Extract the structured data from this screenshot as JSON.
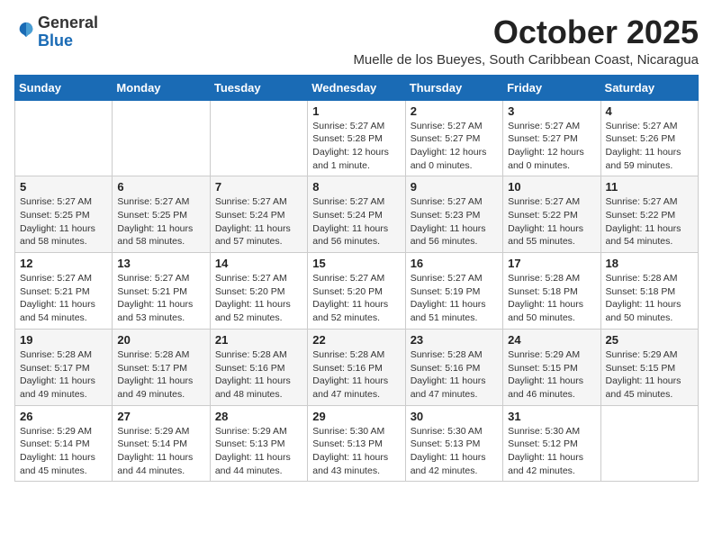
{
  "header": {
    "logo_general": "General",
    "logo_blue": "Blue",
    "month_title": "October 2025",
    "location": "Muelle de los Bueyes, South Caribbean Coast, Nicaragua"
  },
  "days_of_week": [
    "Sunday",
    "Monday",
    "Tuesday",
    "Wednesday",
    "Thursday",
    "Friday",
    "Saturday"
  ],
  "weeks": [
    [
      {
        "day": "",
        "info": ""
      },
      {
        "day": "",
        "info": ""
      },
      {
        "day": "",
        "info": ""
      },
      {
        "day": "1",
        "info": "Sunrise: 5:27 AM\nSunset: 5:28 PM\nDaylight: 12 hours\nand 1 minute."
      },
      {
        "day": "2",
        "info": "Sunrise: 5:27 AM\nSunset: 5:27 PM\nDaylight: 12 hours\nand 0 minutes."
      },
      {
        "day": "3",
        "info": "Sunrise: 5:27 AM\nSunset: 5:27 PM\nDaylight: 12 hours\nand 0 minutes."
      },
      {
        "day": "4",
        "info": "Sunrise: 5:27 AM\nSunset: 5:26 PM\nDaylight: 11 hours\nand 59 minutes."
      }
    ],
    [
      {
        "day": "5",
        "info": "Sunrise: 5:27 AM\nSunset: 5:25 PM\nDaylight: 11 hours\nand 58 minutes."
      },
      {
        "day": "6",
        "info": "Sunrise: 5:27 AM\nSunset: 5:25 PM\nDaylight: 11 hours\nand 58 minutes."
      },
      {
        "day": "7",
        "info": "Sunrise: 5:27 AM\nSunset: 5:24 PM\nDaylight: 11 hours\nand 57 minutes."
      },
      {
        "day": "8",
        "info": "Sunrise: 5:27 AM\nSunset: 5:24 PM\nDaylight: 11 hours\nand 56 minutes."
      },
      {
        "day": "9",
        "info": "Sunrise: 5:27 AM\nSunset: 5:23 PM\nDaylight: 11 hours\nand 56 minutes."
      },
      {
        "day": "10",
        "info": "Sunrise: 5:27 AM\nSunset: 5:22 PM\nDaylight: 11 hours\nand 55 minutes."
      },
      {
        "day": "11",
        "info": "Sunrise: 5:27 AM\nSunset: 5:22 PM\nDaylight: 11 hours\nand 54 minutes."
      }
    ],
    [
      {
        "day": "12",
        "info": "Sunrise: 5:27 AM\nSunset: 5:21 PM\nDaylight: 11 hours\nand 54 minutes."
      },
      {
        "day": "13",
        "info": "Sunrise: 5:27 AM\nSunset: 5:21 PM\nDaylight: 11 hours\nand 53 minutes."
      },
      {
        "day": "14",
        "info": "Sunrise: 5:27 AM\nSunset: 5:20 PM\nDaylight: 11 hours\nand 52 minutes."
      },
      {
        "day": "15",
        "info": "Sunrise: 5:27 AM\nSunset: 5:20 PM\nDaylight: 11 hours\nand 52 minutes."
      },
      {
        "day": "16",
        "info": "Sunrise: 5:27 AM\nSunset: 5:19 PM\nDaylight: 11 hours\nand 51 minutes."
      },
      {
        "day": "17",
        "info": "Sunrise: 5:28 AM\nSunset: 5:18 PM\nDaylight: 11 hours\nand 50 minutes."
      },
      {
        "day": "18",
        "info": "Sunrise: 5:28 AM\nSunset: 5:18 PM\nDaylight: 11 hours\nand 50 minutes."
      }
    ],
    [
      {
        "day": "19",
        "info": "Sunrise: 5:28 AM\nSunset: 5:17 PM\nDaylight: 11 hours\nand 49 minutes."
      },
      {
        "day": "20",
        "info": "Sunrise: 5:28 AM\nSunset: 5:17 PM\nDaylight: 11 hours\nand 49 minutes."
      },
      {
        "day": "21",
        "info": "Sunrise: 5:28 AM\nSunset: 5:16 PM\nDaylight: 11 hours\nand 48 minutes."
      },
      {
        "day": "22",
        "info": "Sunrise: 5:28 AM\nSunset: 5:16 PM\nDaylight: 11 hours\nand 47 minutes."
      },
      {
        "day": "23",
        "info": "Sunrise: 5:28 AM\nSunset: 5:16 PM\nDaylight: 11 hours\nand 47 minutes."
      },
      {
        "day": "24",
        "info": "Sunrise: 5:29 AM\nSunset: 5:15 PM\nDaylight: 11 hours\nand 46 minutes."
      },
      {
        "day": "25",
        "info": "Sunrise: 5:29 AM\nSunset: 5:15 PM\nDaylight: 11 hours\nand 45 minutes."
      }
    ],
    [
      {
        "day": "26",
        "info": "Sunrise: 5:29 AM\nSunset: 5:14 PM\nDaylight: 11 hours\nand 45 minutes."
      },
      {
        "day": "27",
        "info": "Sunrise: 5:29 AM\nSunset: 5:14 PM\nDaylight: 11 hours\nand 44 minutes."
      },
      {
        "day": "28",
        "info": "Sunrise: 5:29 AM\nSunset: 5:13 PM\nDaylight: 11 hours\nand 44 minutes."
      },
      {
        "day": "29",
        "info": "Sunrise: 5:30 AM\nSunset: 5:13 PM\nDaylight: 11 hours\nand 43 minutes."
      },
      {
        "day": "30",
        "info": "Sunrise: 5:30 AM\nSunset: 5:13 PM\nDaylight: 11 hours\nand 42 minutes."
      },
      {
        "day": "31",
        "info": "Sunrise: 5:30 AM\nSunset: 5:12 PM\nDaylight: 11 hours\nand 42 minutes."
      },
      {
        "day": "",
        "info": ""
      }
    ]
  ]
}
